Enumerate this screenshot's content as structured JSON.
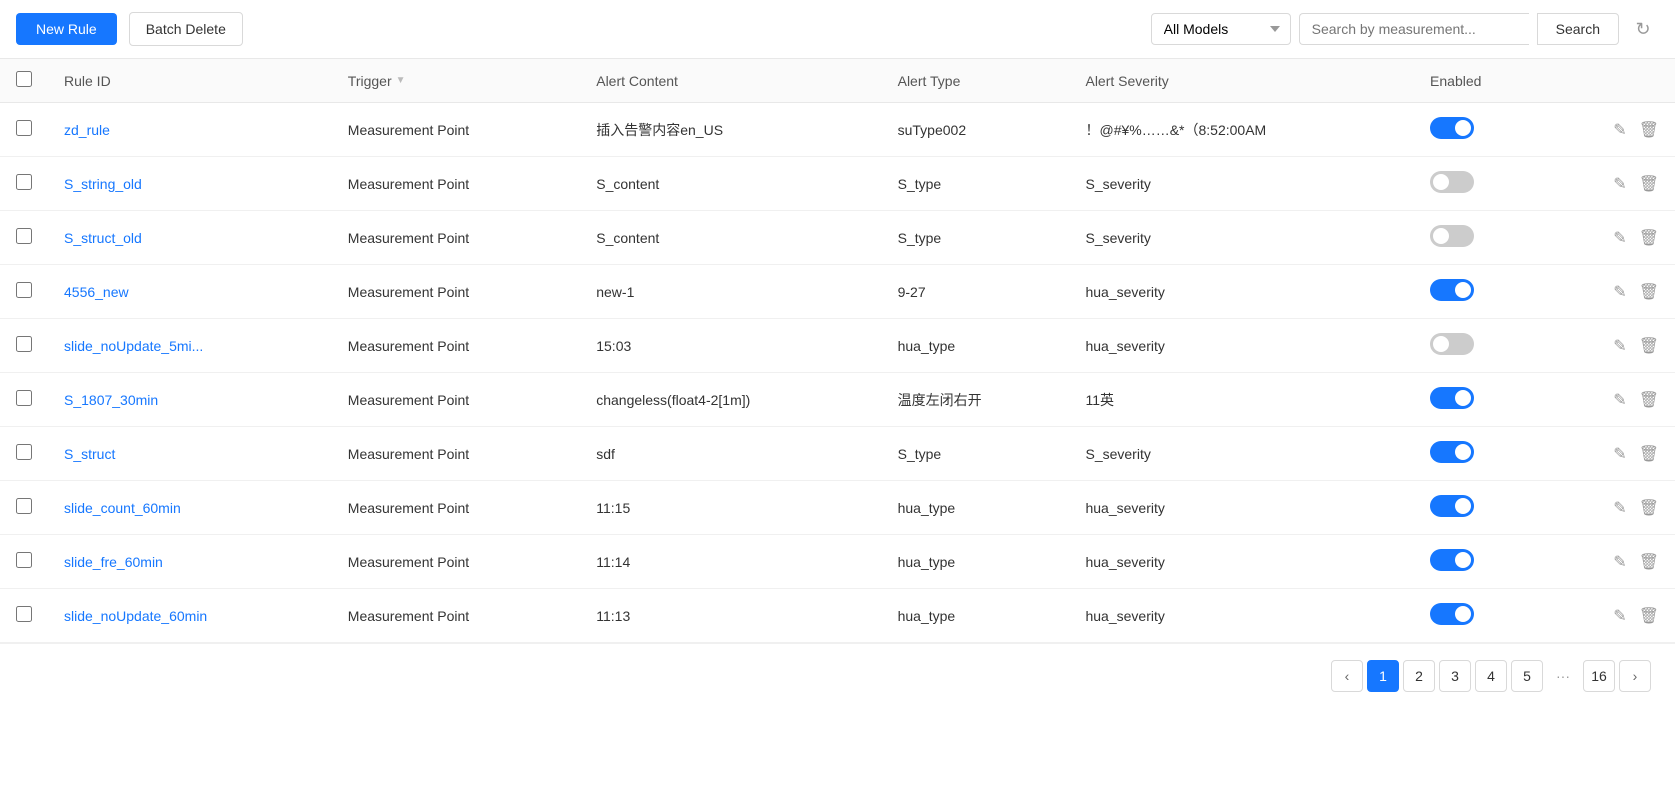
{
  "toolbar": {
    "new_rule_label": "New Rule",
    "batch_delete_label": "Batch Delete",
    "model_options": [
      "All Models"
    ],
    "model_selected": "All Models",
    "search_placeholder": "Search by measurement...",
    "search_label": "Search",
    "refresh_icon": "↻"
  },
  "table": {
    "columns": [
      {
        "key": "checkbox",
        "label": ""
      },
      {
        "key": "rule_id",
        "label": "Rule ID"
      },
      {
        "key": "trigger",
        "label": "Trigger"
      },
      {
        "key": "alert_content",
        "label": "Alert Content"
      },
      {
        "key": "alert_type",
        "label": "Alert Type"
      },
      {
        "key": "alert_severity",
        "label": "Alert Severity"
      },
      {
        "key": "enabled",
        "label": "Enabled"
      },
      {
        "key": "actions",
        "label": ""
      }
    ],
    "rows": [
      {
        "rule_id": "zd_rule",
        "trigger": "Measurement Point",
        "alert_content": "插入告警内容en_US",
        "alert_type": "suType002",
        "alert_severity": "！@#¥%……&*（8:52:00AM",
        "enabled": true
      },
      {
        "rule_id": "S_string_old",
        "trigger": "Measurement Point",
        "alert_content": "S_content",
        "alert_type": "S_type",
        "alert_severity": "S_severity",
        "enabled": false
      },
      {
        "rule_id": "S_struct_old",
        "trigger": "Measurement Point",
        "alert_content": "S_content",
        "alert_type": "S_type",
        "alert_severity": "S_severity",
        "enabled": false
      },
      {
        "rule_id": "4556_new",
        "trigger": "Measurement Point",
        "alert_content": "new-1",
        "alert_type": "9-27",
        "alert_severity": "hua_severity",
        "enabled": true
      },
      {
        "rule_id": "slide_noUpdate_5mi...",
        "trigger": "Measurement Point",
        "alert_content": "15:03",
        "alert_type": "hua_type",
        "alert_severity": "hua_severity",
        "enabled": false
      },
      {
        "rule_id": "S_1807_30min",
        "trigger": "Measurement Point",
        "alert_content": "changeless(float4-2[1m])",
        "alert_type": "温度左闭右开",
        "alert_severity": "11英",
        "enabled": true
      },
      {
        "rule_id": "S_struct",
        "trigger": "Measurement Point",
        "alert_content": "sdf",
        "alert_type": "S_type",
        "alert_severity": "S_severity",
        "enabled": true
      },
      {
        "rule_id": "slide_count_60min",
        "trigger": "Measurement Point",
        "alert_content": "11:15",
        "alert_type": "hua_type",
        "alert_severity": "hua_severity",
        "enabled": true
      },
      {
        "rule_id": "slide_fre_60min",
        "trigger": "Measurement Point",
        "alert_content": "11:14",
        "alert_type": "hua_type",
        "alert_severity": "hua_severity",
        "enabled": true
      },
      {
        "rule_id": "slide_noUpdate_60min",
        "trigger": "Measurement Point",
        "alert_content": "11:13",
        "alert_type": "hua_type",
        "alert_severity": "hua_severity",
        "enabled": true
      }
    ]
  },
  "pagination": {
    "prev_label": "‹",
    "next_label": "›",
    "pages": [
      "1",
      "2",
      "3",
      "4",
      "5"
    ],
    "ellipsis": "···",
    "last_page": "16",
    "current_page": 1
  }
}
